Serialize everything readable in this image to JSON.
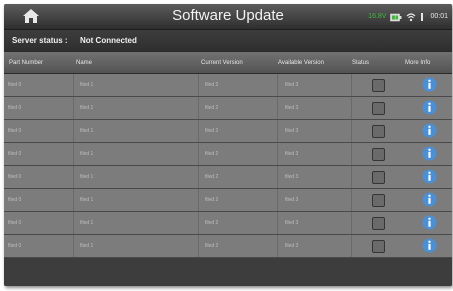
{
  "header": {
    "title": "Software Update",
    "home_icon": "home-icon",
    "voltage": "16.8V",
    "clock": "00:01",
    "status_icons": [
      "battery-plug-icon",
      "wifi-icon",
      "signal-bar-icon"
    ],
    "voltage_color": "#3fb83a"
  },
  "server": {
    "label": "Server status :",
    "value": "Not Connected"
  },
  "table": {
    "columns": [
      "Part Number",
      "Name",
      "Current Version",
      "Available Version",
      "Status",
      "More Info"
    ],
    "rows": [
      {
        "c0": "filed 0",
        "c1": "filed 1",
        "c2": "filed 2",
        "c3": "filed 3",
        "status_checked": false
      },
      {
        "c0": "filed 0",
        "c1": "filed 1",
        "c2": "filed 2",
        "c3": "filed 3",
        "status_checked": false
      },
      {
        "c0": "filed 0",
        "c1": "filed 1",
        "c2": "filed 2",
        "c3": "filed 3",
        "status_checked": false
      },
      {
        "c0": "filed 0",
        "c1": "filed 1",
        "c2": "filed 2",
        "c3": "filed 3",
        "status_checked": false
      },
      {
        "c0": "filed 0",
        "c1": "filed 1",
        "c2": "filed 2",
        "c3": "filed 3",
        "status_checked": false
      },
      {
        "c0": "filed 0",
        "c1": "filed 1",
        "c2": "filed 2",
        "c3": "filed 3",
        "status_checked": false
      },
      {
        "c0": "filed 0",
        "c1": "filed 1",
        "c2": "filed 2",
        "c3": "filed 3",
        "status_checked": false
      },
      {
        "c0": "filed 0",
        "c1": "filed 1",
        "c2": "filed 2",
        "c3": "filed 3",
        "status_checked": false
      }
    ],
    "info_icon": "info-icon",
    "info_color": "#4a90d6"
  }
}
